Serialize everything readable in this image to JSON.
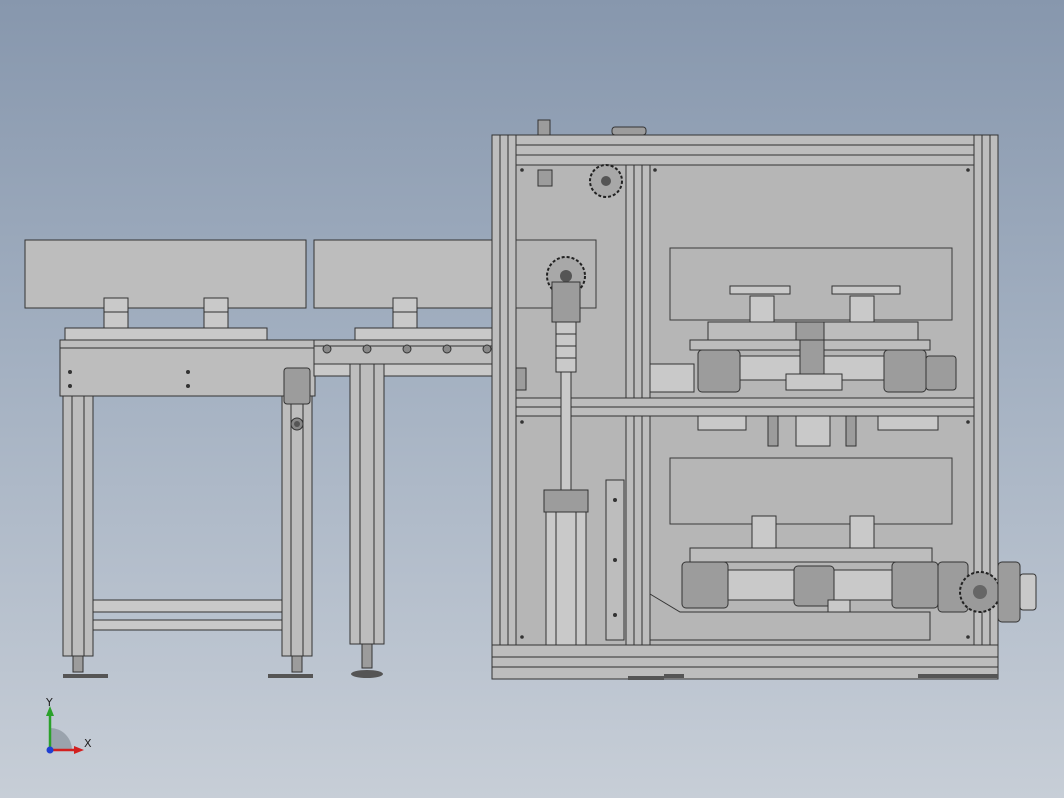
{
  "view": {
    "background_top": "#8797ad",
    "background_bottom": "#c7ced7",
    "model_color": "#bdbdbd"
  },
  "triad": {
    "x_label": "X",
    "y_label": "Y",
    "x_color": "#d21f1f",
    "y_color": "#2aa12a",
    "z_color": "#1f3fd2"
  }
}
